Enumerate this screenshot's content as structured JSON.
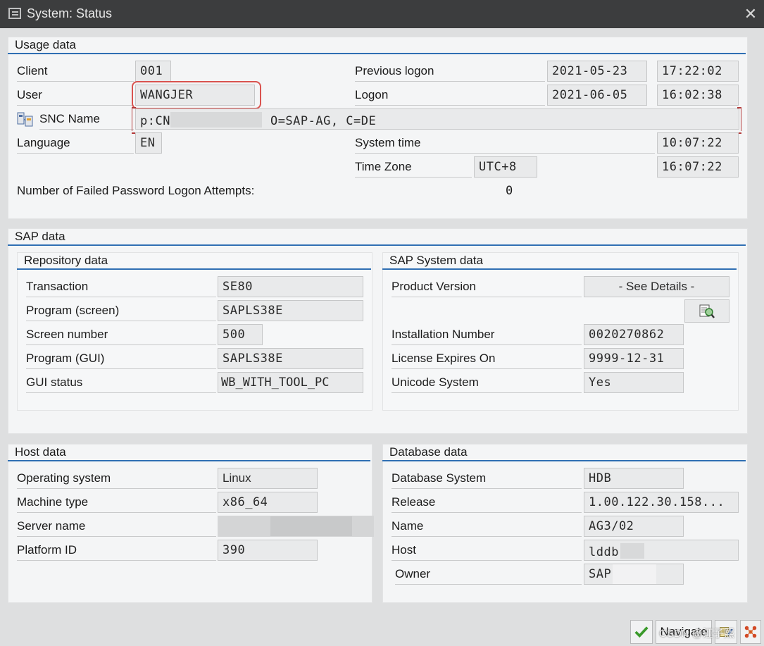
{
  "window": {
    "title": "System: Status"
  },
  "usage": {
    "title": "Usage data",
    "client_label": "Client",
    "client": "001",
    "user_label": "User",
    "user": "WANGJER",
    "snc_label": "SNC Name",
    "snc_prefix": "p:CN",
    "snc_suffix": "O=SAP-AG,  C=DE",
    "language_label": "Language",
    "language": "EN",
    "prev_logon_label": "Previous logon",
    "prev_logon_date": "2021-05-23",
    "prev_logon_time": "17:22:02",
    "logon_label": "Logon",
    "logon_date": "2021-06-05",
    "logon_time": "16:02:38",
    "system_time_label": "System time",
    "system_time": "10:07:22",
    "timezone_label": "Time Zone",
    "timezone": "UTC+8",
    "timezone_time": "16:07:22",
    "failed_label": "Number of Failed Password Logon Attempts:",
    "failed": "0"
  },
  "sap": {
    "title": "SAP data",
    "repo": {
      "title": "Repository data",
      "transaction_label": "Transaction",
      "transaction": "SE80",
      "program_screen_label": "Program (screen)",
      "program_screen": "SAPLS38E",
      "screen_number_label": "Screen number",
      "screen_number": "500",
      "program_gui_label": "Program (GUI)",
      "program_gui": "SAPLS38E",
      "gui_status_label": "GUI status",
      "gui_status": "WB_WITH_TOOL_PC"
    },
    "system": {
      "title": "SAP System data",
      "product_version_label": "Product Version",
      "product_version": "- See Details -",
      "installation_label": "Installation Number",
      "installation": "0020270862",
      "license_label": "License Expires On",
      "license": "9999-12-31",
      "unicode_label": "Unicode System",
      "unicode": "Yes"
    }
  },
  "host": {
    "title": "Host data",
    "os_label": "Operating system",
    "os": "Linux",
    "machine_label": "Machine type",
    "machine": "x86_64",
    "server_label": "Server name",
    "platform_label": "Platform ID",
    "platform": "390"
  },
  "db": {
    "title": "Database data",
    "system_label": "Database System",
    "system": "HDB",
    "release_label": "Release",
    "release": "1.00.122.30.158...",
    "name_label": "Name",
    "name": "AG3/02",
    "host_label": "Host",
    "host": "lddb",
    "owner_label": "Owner",
    "owner": "SAP"
  },
  "footer": {
    "navigate_label": "Navigate",
    "watermark": "CSDN @汪子熙"
  },
  "colors": {
    "accent": "#2f6fb3",
    "ok_green": "#3a9a2b",
    "highlight": "#d9534f"
  }
}
